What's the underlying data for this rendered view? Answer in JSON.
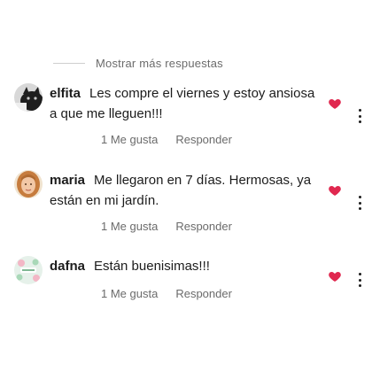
{
  "thread": {
    "show_more_label": "Mostrar más respuestas"
  },
  "accent_like_color": "#e0284f",
  "comments": [
    {
      "username": "elfita",
      "text": "Les compre el viernes y estoy ansiosa a que me lleguen!!!",
      "likes_label": "1 Me gusta",
      "reply_label": "Responder",
      "avatar_icon": "cat-photo-avatar"
    },
    {
      "username": "maria",
      "text": "Me llegaron en 7 días. Hermosas, ya están en mi jardín.",
      "likes_label": "1 Me gusta",
      "reply_label": "Responder",
      "avatar_icon": "woman-photo-avatar"
    },
    {
      "username": "dafna",
      "text": "Están buenisimas!!!",
      "likes_label": "1 Me gusta",
      "reply_label": "Responder",
      "avatar_icon": "floral-logo-avatar"
    }
  ]
}
